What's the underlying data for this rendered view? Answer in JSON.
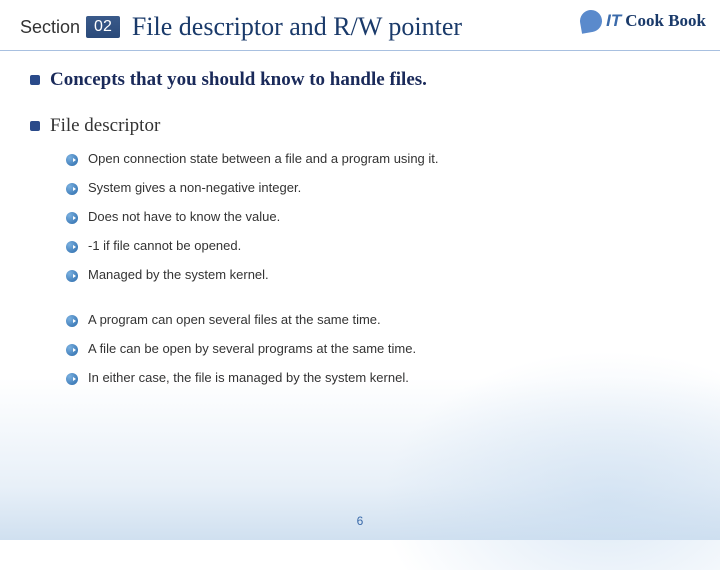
{
  "header": {
    "section_label": "Section",
    "section_num": "02",
    "title": "File descriptor and R/W pointer"
  },
  "brand": {
    "it": "IT",
    "cook": "Cook Book"
  },
  "content": {
    "intro": "Concepts that you should know to handle files.",
    "topic": "File descriptor",
    "points_a": [
      "Open connection state between a file and a program using it.",
      "System gives a non-negative integer.",
      "Does not have to know the value.",
      "-1 if file cannot be opened.",
      "Managed by the system kernel."
    ],
    "points_b": [
      "A program can open several files at the same time.",
      "A file can be open by several programs at the same time.",
      "In either case, the file is managed by the system kernel."
    ]
  },
  "page_number": "6"
}
